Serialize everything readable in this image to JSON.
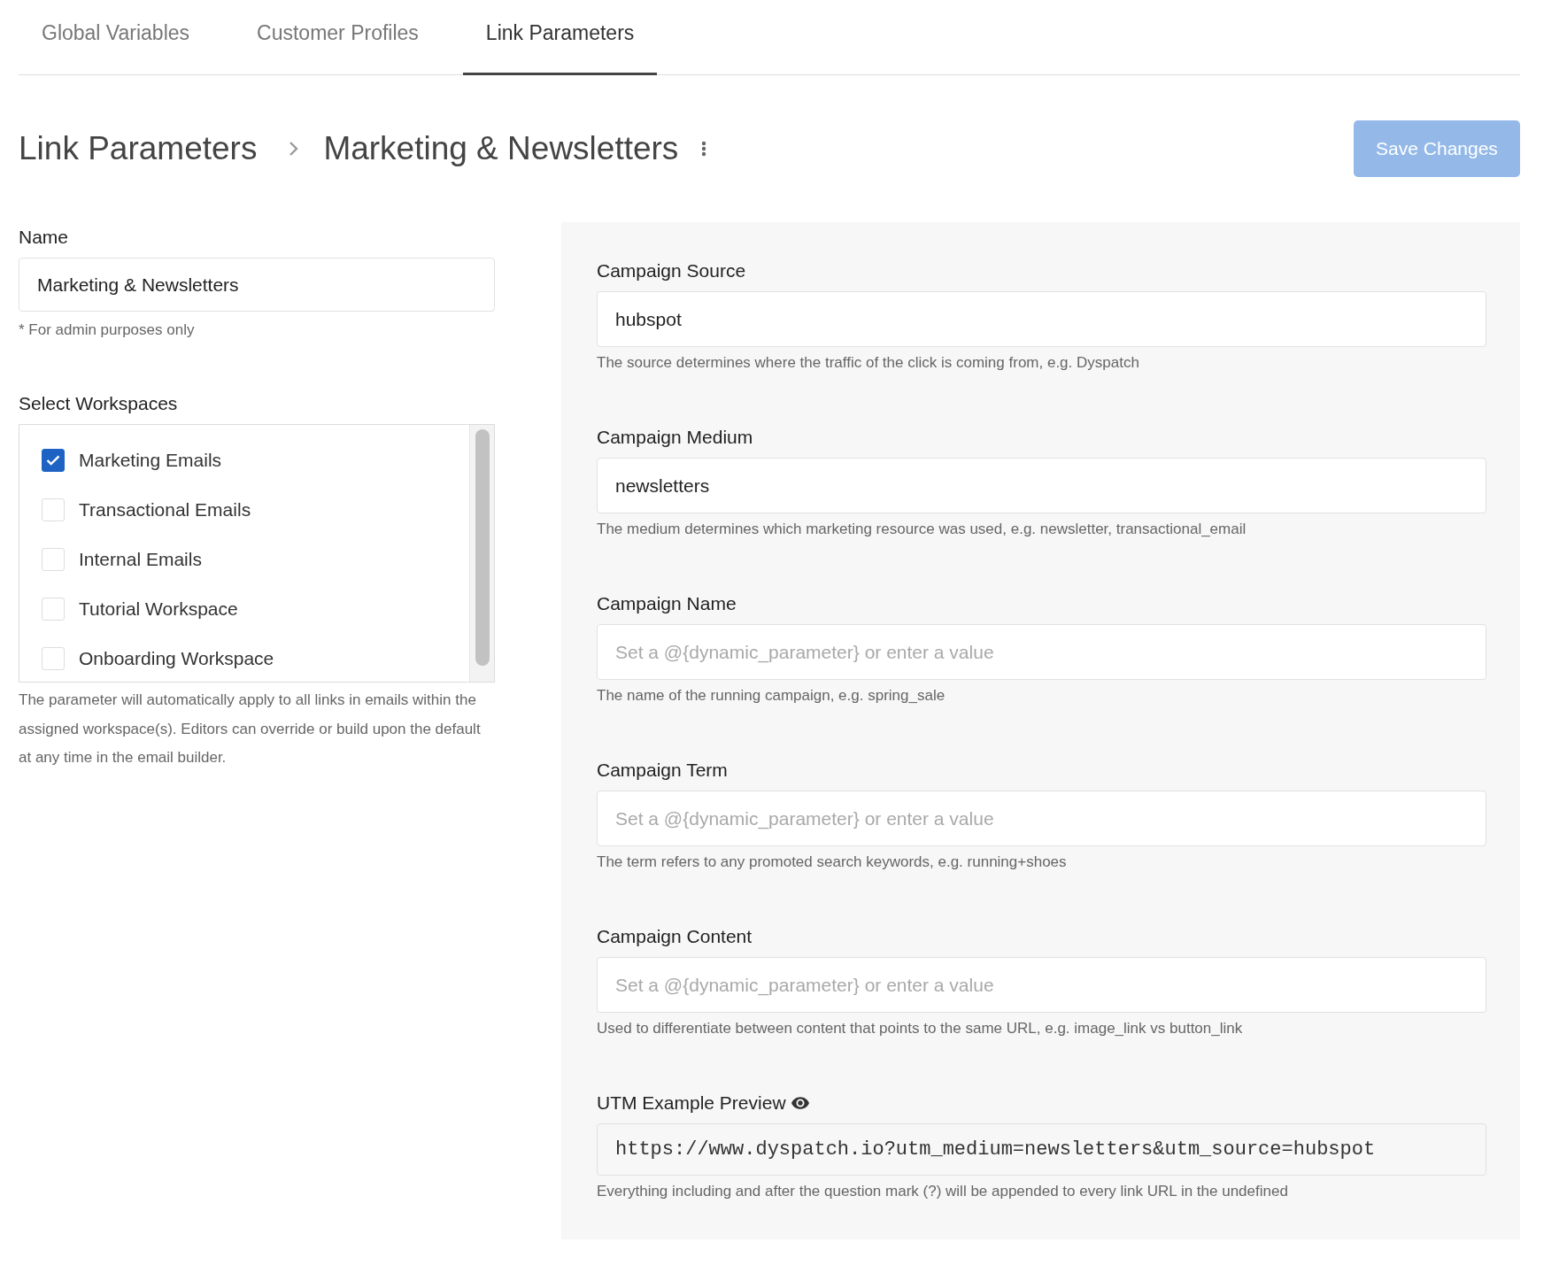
{
  "tabs": [
    {
      "label": "Global Variables",
      "selected": false
    },
    {
      "label": "Customer Profiles",
      "selected": false
    },
    {
      "label": "Link Parameters",
      "selected": true
    }
  ],
  "header": {
    "breadcrumb": [
      "Link Parameters",
      "Marketing & Newsletters"
    ],
    "save_button": {
      "label": "Save Changes",
      "disabled": true
    }
  },
  "name_field": {
    "label": "Name",
    "value": "Marketing & Newsletters",
    "hint": "* For admin purposes only"
  },
  "workspaces": {
    "label": "Select Workspaces",
    "items": [
      {
        "label": "Marketing Emails",
        "checked": true
      },
      {
        "label": "Transactional Emails",
        "checked": false
      },
      {
        "label": "Internal Emails",
        "checked": false
      },
      {
        "label": "Tutorial Workspace",
        "checked": false
      },
      {
        "label": "Onboarding Workspace",
        "checked": false
      }
    ],
    "description": "The parameter will automatically apply to all links in emails within the assigned workspace(s). Editors can override or build upon the default at any time in the email builder."
  },
  "utm_fields": [
    {
      "label": "Campaign Source",
      "value": "hubspot",
      "description": "The source determines where the traffic of the click is coming from, e.g. Dyspatch"
    },
    {
      "label": "Campaign Medium",
      "value": "newsletters",
      "description": "The medium determines which marketing resource was used, e.g. newsletter, transactional_email"
    },
    {
      "label": "Campaign Name",
      "placeholder": "Set a @{dynamic_parameter} or enter a value",
      "description": "The name of the running campaign, e.g. spring_sale"
    },
    {
      "label": "Campaign Term",
      "placeholder": "Set a @{dynamic_parameter} or enter a value",
      "description": "The term refers to any promoted search keywords, e.g. running+shoes"
    },
    {
      "label": "Campaign Content",
      "placeholder": "Set a @{dynamic_parameter} or enter a value",
      "description": "Used to differentiate between content that points to the same URL, e.g. image_link vs button_link"
    }
  ],
  "utm_preview": {
    "label": "UTM Example Preview",
    "value": "https://www.dyspatch.io?utm_medium=newsletters&utm_source=hubspot",
    "description": "Everything including and after the question mark (?) will be appended to every link URL in the undefined"
  }
}
